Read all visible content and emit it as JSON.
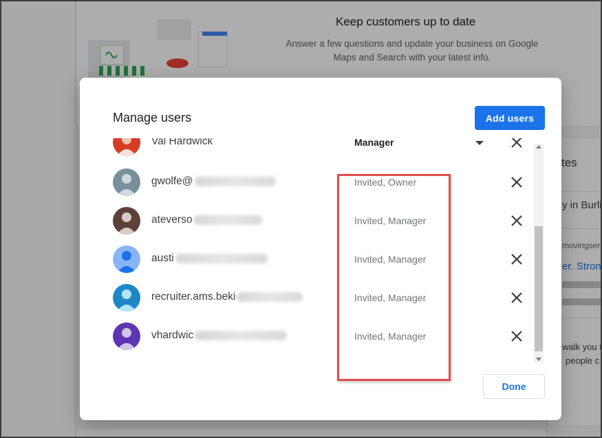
{
  "background": {
    "card_title": "Keep customers up to date",
    "card_description": "Answer a few questions and update your business on Google Maps and Search with your latest info.",
    "right_heading_fragment": "tes",
    "right_location_fragment": "y in Burlin",
    "right_small_fragment": "movingser",
    "right_link_fragment": "er. Stron",
    "right_walk_fragment": "walk you t",
    "right_people_fragment": "people c"
  },
  "dialog": {
    "title": "Manage users",
    "add_users_label": "Add users",
    "done_label": "Done",
    "users": [
      {
        "name": "Val Hardwick",
        "role": "Manager",
        "role_is_select": true,
        "avatar": "photo-avatar",
        "avatar_color": "#d93c24"
      },
      {
        "name": "gwolfe@",
        "role": "Invited, Owner",
        "role_is_select": false,
        "avatar": "person-icon",
        "avatar_color": "#78909c"
      },
      {
        "name": "ateverso",
        "role": "Invited, Manager",
        "role_is_select": false,
        "avatar": "photo-avatar",
        "avatar_color": "#5d4037"
      },
      {
        "name": "austi",
        "role": "Invited, Manager",
        "role_is_select": false,
        "avatar": "person-icon",
        "avatar_color": "#4285f4"
      },
      {
        "name": "recruiter.ams.beki",
        "role": "Invited, Manager",
        "role_is_select": false,
        "avatar": "person-icon",
        "avatar_color": "#1e88c7"
      },
      {
        "name": "vhardwic",
        "role": "Invited, Manager",
        "role_is_select": false,
        "avatar": "person-icon",
        "avatar_color": "#5e35b1"
      }
    ]
  },
  "colors": {
    "primary": "#1a73e8",
    "highlight": "#e04b4b"
  }
}
